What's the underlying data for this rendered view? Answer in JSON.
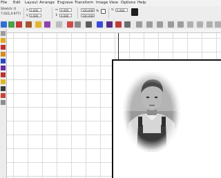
{
  "menu": [
    {
      "label": "File"
    },
    {
      "label": "Edit"
    },
    {
      "label": "Layout"
    },
    {
      "label": "Arrange"
    },
    {
      "label": "Engrave"
    },
    {
      "label": "Transform"
    },
    {
      "label": "Image"
    },
    {
      "label": "View"
    },
    {
      "label": "Options"
    },
    {
      "label": "Help"
    }
  ],
  "props": {
    "style_label": "Stretch: 0",
    "coords": "7.022,4.977)",
    "x_value": "0.000",
    "y_value": "0.000",
    "w_value": "100.000",
    "h_value": "100.000",
    "angle_value": "0.000"
  },
  "colors": {
    "chrome": "#ececec",
    "grid": "#dadada",
    "page_border": "#111111"
  }
}
